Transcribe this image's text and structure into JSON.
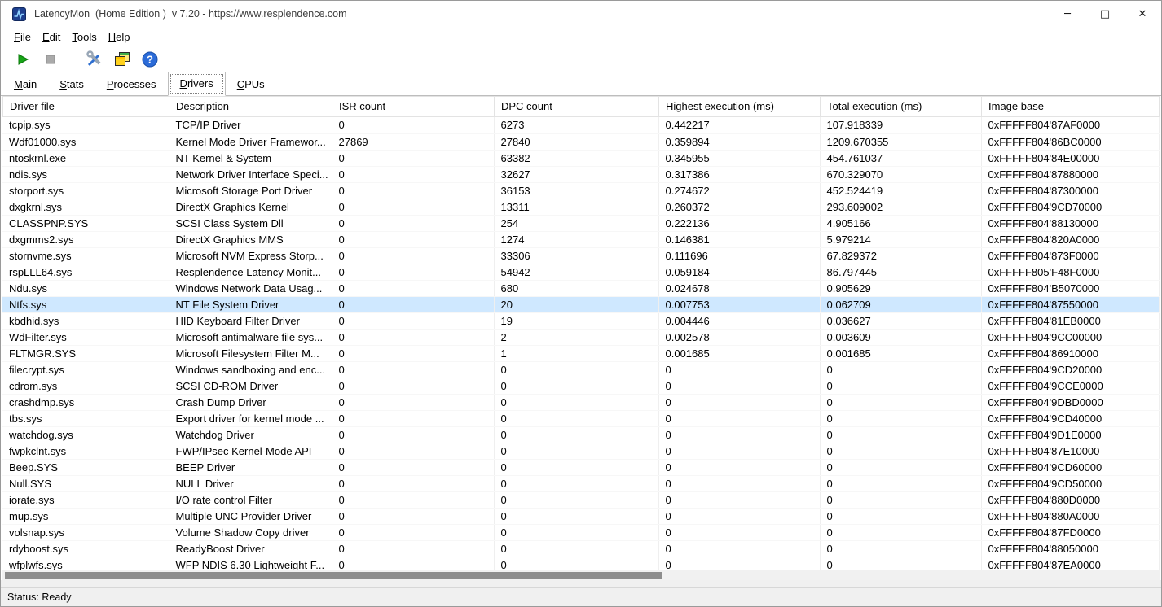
{
  "window": {
    "title": "LatencyMon  (Home Edition )  v 7.20 - https://www.resplendence.com",
    "controls": {
      "minimize_icon": "─",
      "maximize_icon": "□",
      "close_icon": "✕"
    }
  },
  "menu": {
    "items": [
      "File",
      "Edit",
      "Tools",
      "Help"
    ]
  },
  "toolbar": {
    "buttons": [
      {
        "name": "start-monitor",
        "icon": "play-icon",
        "enabled": true
      },
      {
        "name": "stop-monitor",
        "icon": "stop-icon",
        "enabled": false
      },
      {
        "name": "tools-options",
        "icon": "wrench-icon",
        "enabled": true
      },
      {
        "name": "copy-report",
        "icon": "copy-windows-icon",
        "enabled": true
      },
      {
        "name": "help",
        "icon": "help-question-icon",
        "enabled": true
      }
    ]
  },
  "tabs": {
    "items": [
      "Main",
      "Stats",
      "Processes",
      "Drivers",
      "CPUs"
    ],
    "selected": "Drivers"
  },
  "table": {
    "columns": [
      "Driver file",
      "Description",
      "ISR count",
      "DPC count",
      "Highest execution (ms)",
      "Total execution (ms)",
      "Image base"
    ],
    "selected_row_index": 11,
    "rows": [
      [
        "tcpip.sys",
        "TCP/IP Driver",
        "0",
        "6273",
        "0.442217",
        "107.918339",
        "0xFFFFF804'87AF0000"
      ],
      [
        "Wdf01000.sys",
        "Kernel Mode Driver Framewor...",
        "27869",
        "27840",
        "0.359894",
        "1209.670355",
        "0xFFFFF804'86BC0000"
      ],
      [
        "ntoskrnl.exe",
        "NT Kernel & System",
        "0",
        "63382",
        "0.345955",
        "454.761037",
        "0xFFFFF804'84E00000"
      ],
      [
        "ndis.sys",
        "Network Driver Interface Speci...",
        "0",
        "32627",
        "0.317386",
        "670.329070",
        "0xFFFFF804'87880000"
      ],
      [
        "storport.sys",
        "Microsoft Storage Port Driver",
        "0",
        "36153",
        "0.274672",
        "452.524419",
        "0xFFFFF804'87300000"
      ],
      [
        "dxgkrnl.sys",
        "DirectX Graphics Kernel",
        "0",
        "13311",
        "0.260372",
        "293.609002",
        "0xFFFFF804'9CD70000"
      ],
      [
        "CLASSPNP.SYS",
        "SCSI Class System Dll",
        "0",
        "254",
        "0.222136",
        "4.905166",
        "0xFFFFF804'88130000"
      ],
      [
        "dxgmms2.sys",
        "DirectX Graphics MMS",
        "0",
        "1274",
        "0.146381",
        "5.979214",
        "0xFFFFF804'820A0000"
      ],
      [
        "stornvme.sys",
        "Microsoft NVM Express Storp...",
        "0",
        "33306",
        "0.111696",
        "67.829372",
        "0xFFFFF804'873F0000"
      ],
      [
        "rspLLL64.sys",
        "Resplendence Latency Monit...",
        "0",
        "54942",
        "0.059184",
        "86.797445",
        "0xFFFFF805'F48F0000"
      ],
      [
        "Ndu.sys",
        "Windows Network Data Usag...",
        "0",
        "680",
        "0.024678",
        "0.905629",
        "0xFFFFF804'B5070000"
      ],
      [
        "Ntfs.sys",
        "NT File System Driver",
        "0",
        "20",
        "0.007753",
        "0.062709",
        "0xFFFFF804'87550000"
      ],
      [
        "kbdhid.sys",
        "HID Keyboard Filter Driver",
        "0",
        "19",
        "0.004446",
        "0.036627",
        "0xFFFFF804'81EB0000"
      ],
      [
        "WdFilter.sys",
        "Microsoft antimalware file sys...",
        "0",
        "2",
        "0.002578",
        "0.003609",
        "0xFFFFF804'9CC00000"
      ],
      [
        "FLTMGR.SYS",
        "Microsoft Filesystem Filter M...",
        "0",
        "1",
        "0.001685",
        "0.001685",
        "0xFFFFF804'86910000"
      ],
      [
        "filecrypt.sys",
        "Windows sandboxing and enc...",
        "0",
        "0",
        "0",
        "0",
        "0xFFFFF804'9CD20000"
      ],
      [
        "cdrom.sys",
        "SCSI CD-ROM Driver",
        "0",
        "0",
        "0",
        "0",
        "0xFFFFF804'9CCE0000"
      ],
      [
        "crashdmp.sys",
        "Crash Dump Driver",
        "0",
        "0",
        "0",
        "0",
        "0xFFFFF804'9DBD0000"
      ],
      [
        "tbs.sys",
        "Export driver for kernel mode ...",
        "0",
        "0",
        "0",
        "0",
        "0xFFFFF804'9CD40000"
      ],
      [
        "watchdog.sys",
        "Watchdog Driver",
        "0",
        "0",
        "0",
        "0",
        "0xFFFFF804'9D1E0000"
      ],
      [
        "fwpkclnt.sys",
        "FWP/IPsec Kernel-Mode API",
        "0",
        "0",
        "0",
        "0",
        "0xFFFFF804'87E10000"
      ],
      [
        "Beep.SYS",
        "BEEP Driver",
        "0",
        "0",
        "0",
        "0",
        "0xFFFFF804'9CD60000"
      ],
      [
        "Null.SYS",
        "NULL Driver",
        "0",
        "0",
        "0",
        "0",
        "0xFFFFF804'9CD50000"
      ],
      [
        "iorate.sys",
        "I/O rate control Filter",
        "0",
        "0",
        "0",
        "0",
        "0xFFFFF804'880D0000"
      ],
      [
        "mup.sys",
        "Multiple UNC Provider Driver",
        "0",
        "0",
        "0",
        "0",
        "0xFFFFF804'880A0000"
      ],
      [
        "volsnap.sys",
        "Volume Shadow Copy driver",
        "0",
        "0",
        "0",
        "0",
        "0xFFFFF804'87FD0000"
      ],
      [
        "rdyboost.sys",
        "ReadyBoost Driver",
        "0",
        "0",
        "0",
        "0",
        "0xFFFFF804'88050000"
      ],
      [
        "wfplwfs.sys",
        "WFP NDIS 6.30 Lightweight F...",
        "0",
        "0",
        "0",
        "0",
        "0xFFFFF804'87EA0000"
      ]
    ]
  },
  "colors": {
    "selection": "#cfe8ff",
    "play_green": "#17a517",
    "help_blue": "#2b6bd8"
  },
  "status_bar": {
    "text": "Status: Ready"
  }
}
